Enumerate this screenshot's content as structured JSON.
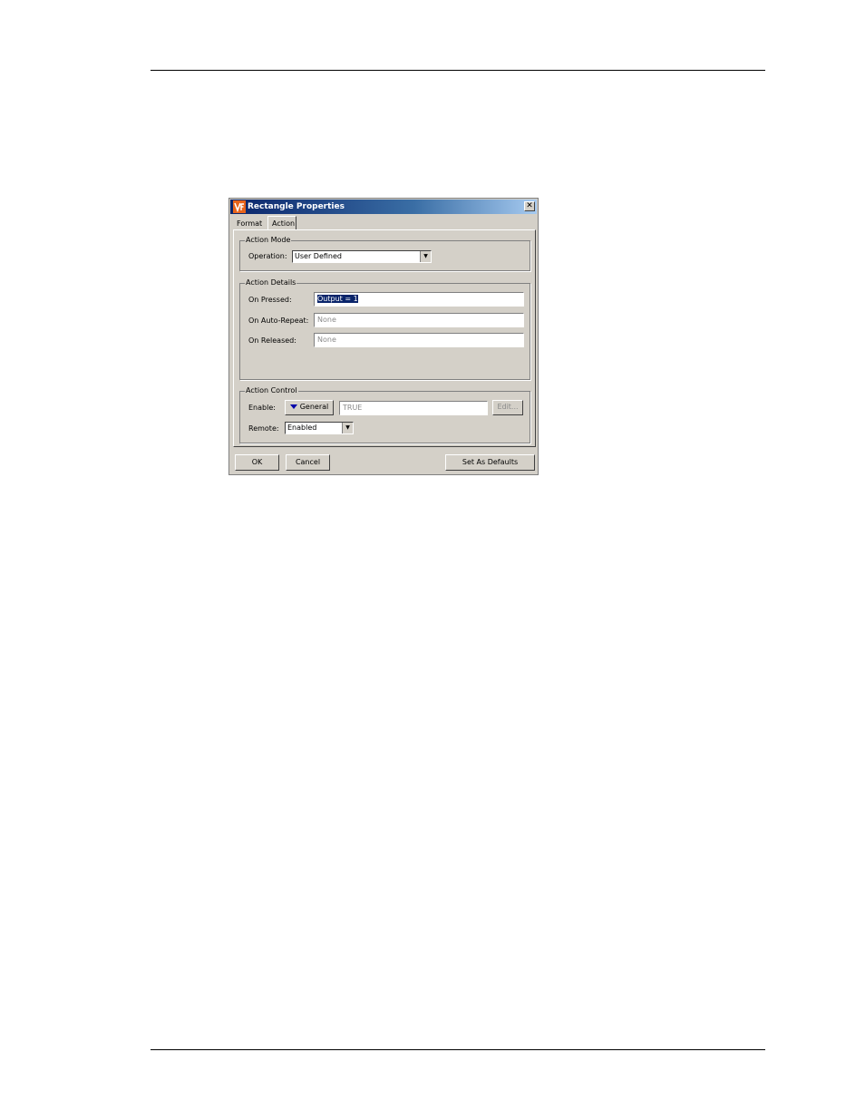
{
  "dialog": {
    "title": "Rectangle Properties",
    "close_glyph": "✕",
    "tabs": [
      "Format",
      "Action"
    ],
    "active_tab": "Action",
    "action_mode": {
      "legend": "Action Mode",
      "operation_label": "Operation:",
      "operation_value": "User Defined"
    },
    "action_details": {
      "legend": "Action Details",
      "on_pressed_label": "On Pressed:",
      "on_pressed_value": "Output = 1",
      "on_auto_repeat_label": "On Auto-Repeat:",
      "on_auto_repeat_value": "None",
      "on_released_label": "On Released:",
      "on_released_value": "None"
    },
    "action_control": {
      "legend": "Action Control",
      "enable_label": "Enable:",
      "enable_mode_button": "General",
      "enable_value": "TRUE",
      "edit_button": "Edit...",
      "remote_label": "Remote:",
      "remote_value": "Enabled"
    },
    "buttons": {
      "ok": "OK",
      "cancel": "Cancel",
      "set_defaults": "Set As Defaults"
    }
  },
  "colors": {
    "titlebar_start": "#0a246a",
    "titlebar_end": "#a6caf0",
    "dialog_face": "#d4d0c8",
    "icon_orange": "#e8641b"
  }
}
